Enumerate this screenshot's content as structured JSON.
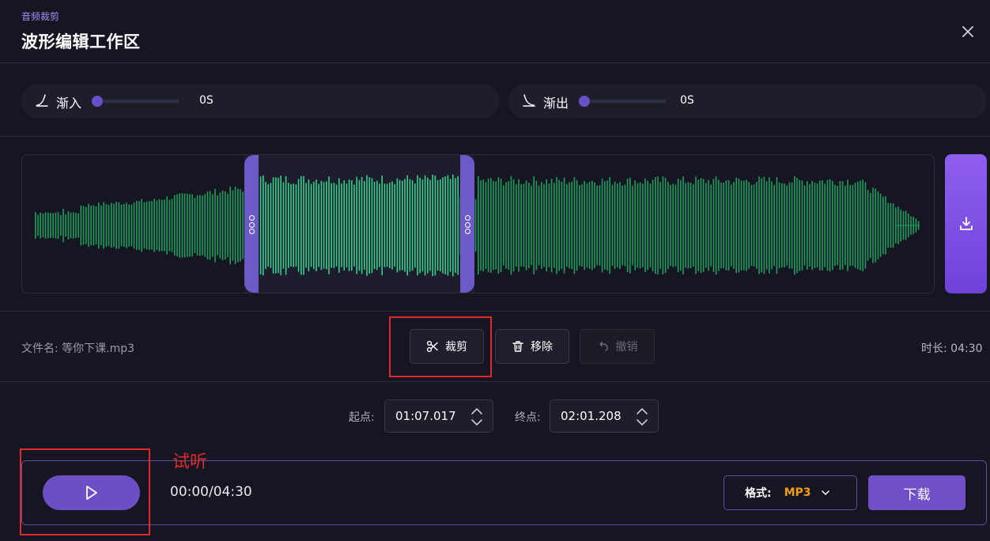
{
  "header": {
    "subtitle": "音频裁剪",
    "title": "波形编辑工作区"
  },
  "fade_in": {
    "label": "渐入",
    "value": "0S",
    "level": 0
  },
  "fade_out": {
    "label": "渐出",
    "value": "0S",
    "level": 0
  },
  "waveform": {
    "selection_start_fraction": 0.243,
    "selection_end_fraction": 0.464
  },
  "file": {
    "name_label": "文件名: 等你下课.mp3",
    "duration_label": "时长: 04:30"
  },
  "actions": {
    "cut_label": "裁剪",
    "remove_label": "移除",
    "undo_label": "撤销"
  },
  "range": {
    "start_label": "起点:",
    "start_value": "01:07.017",
    "end_label": "终点:",
    "end_value": "02:01.208"
  },
  "player": {
    "time_display": "00:00/04:30",
    "annotation": "试听"
  },
  "export": {
    "format_label": "格式:",
    "format_value": "MP3",
    "download_label": "下载"
  },
  "colors": {
    "accent": "#6c4fc4",
    "wave": "#1f9e5c",
    "wave_selected": "#34d08a",
    "format": "#f59e0b",
    "annotation": "#e02b2b"
  }
}
